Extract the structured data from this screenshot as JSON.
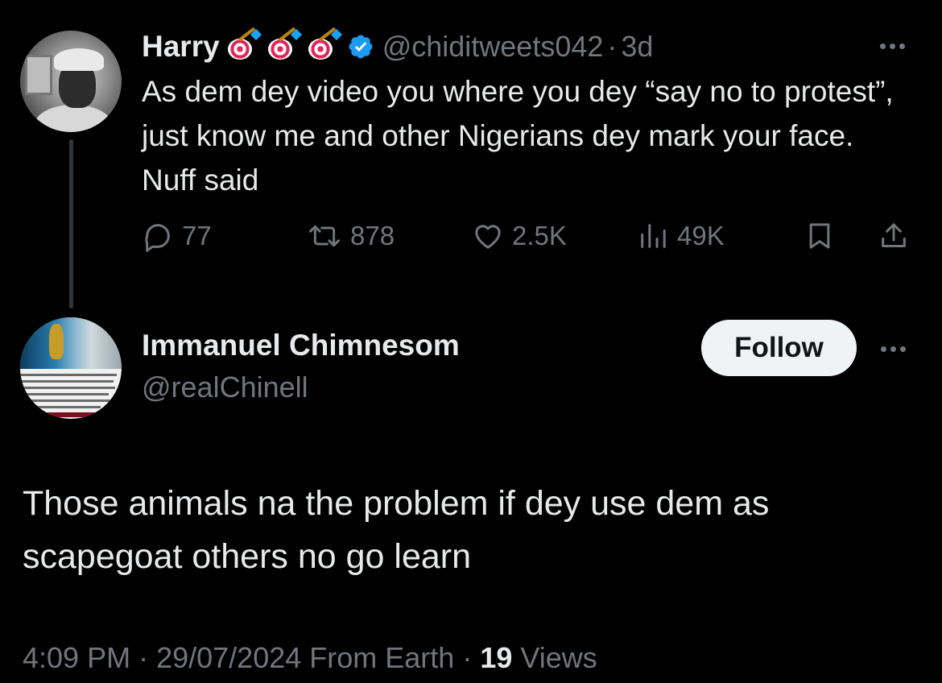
{
  "parent_tweet": {
    "display_name": "Harry",
    "emoji_badges": [
      "direct-hit-dart-emoji",
      "direct-hit-dart-emoji",
      "direct-hit-dart-emoji"
    ],
    "verified": true,
    "handle": "@chiditweets042",
    "separator": "·",
    "time_ago": "3d",
    "text": "As dem dey video you where you dey “say no to protest”, just know me and other Nigerians dey mark your face. Nuff said",
    "stats": {
      "replies": "77",
      "retweets": "878",
      "likes": "2.5K",
      "views": "49K"
    }
  },
  "reply_tweet": {
    "display_name": "Immanuel Chimnesom",
    "handle": "@realChinell",
    "follow_label": "Follow",
    "text": "Those animals na the problem if dey use dem as scapegoat others no go learn",
    "meta": {
      "time": "4:09 PM",
      "sep1": " · ",
      "date": "29/07/2024",
      "source": " From Earth",
      "sep2": " · ",
      "views_count": "19",
      "views_label": " Views"
    }
  },
  "colors": {
    "background": "#000000",
    "primary_text": "#e7e9ea",
    "secondary_text": "#71767b",
    "verified_blue": "#1d9bf0",
    "follow_bg": "#eff3f4"
  }
}
